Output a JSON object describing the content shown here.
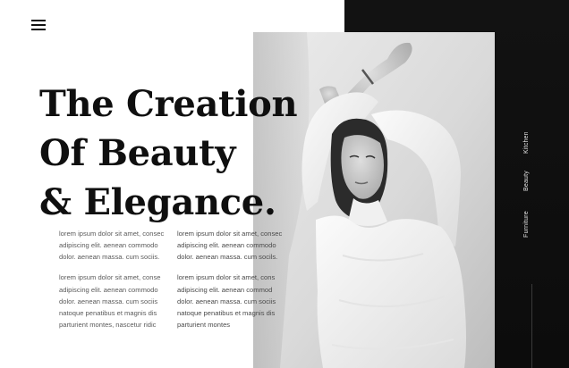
{
  "header": {
    "menu_icon": "hamburger-menu-icon"
  },
  "hero": {
    "headline_lines": [
      "The Creation",
      "Of Beauty",
      "& Elegance."
    ]
  },
  "body_text": {
    "left_column": [
      "lorem ipsum dolor sit amet, consec adipiscing elit. aenean commodo dolor. aenean massa. cum sociis.",
      "lorem ipsum dolor sit amet, conse adipiscing elit. aenean commodo dolor. aenean massa. cum sociis natoque penatibus et magnis dis parturient montes, nascetur ridic"
    ],
    "right_column": [
      "lorem ipsum dolor sit amet, consec adipiscing elit. aenean commodo dolor. aenean massa. cum socils.",
      "lorem ipsum dolor sit amet, cons adipiscing elit. aenean commod dolor. aenean massa. cum sociis natoque penatibus et magnis dis parturient montes"
    ]
  },
  "side_nav": {
    "items": [
      "Kitchen",
      "Beauty",
      "Furniture"
    ]
  },
  "colors": {
    "background": "#ffffff",
    "dark_panel": "#0f0f0f",
    "headline": "#0f0f0f",
    "body_text": "#5b5b5b",
    "nav_text": "#e6e6e6"
  }
}
